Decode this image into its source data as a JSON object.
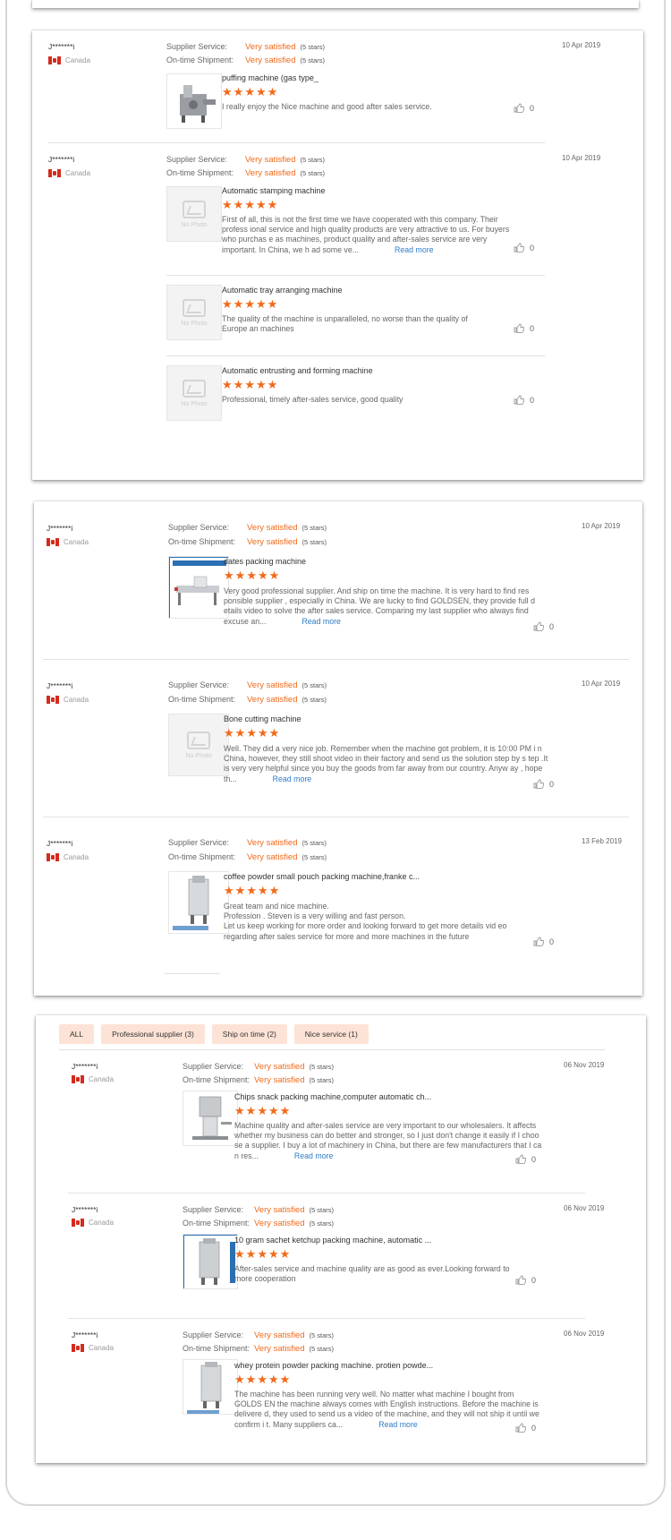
{
  "labels": {
    "supplier_service": "Supplier Service:",
    "ontime_shipment": "On-time Shipment:",
    "very_satisfied": "Very satisfied",
    "five_stars": "(5 stars)",
    "read_more": "Read more",
    "no_photo": "No Photo"
  },
  "filters": [
    "ALL",
    "Professional supplier (3)",
    "Ship on time (2)",
    "Nice service (1)"
  ],
  "card1": {
    "reviews": [
      {
        "user": "J*******i",
        "country": "Canada",
        "date": "10 Apr 2019",
        "products": [
          {
            "title": "puffing machine (gas type_",
            "text": "I really enjoy the Nice machine and good after sales service.",
            "likes": "0",
            "has_photo": true
          }
        ]
      },
      {
        "user": "J*******i",
        "country": "Canada",
        "date": "10 Apr 2019",
        "products": [
          {
            "title": "Automatic stamping machine",
            "text": "First of all, this is not the first time we have cooperated with this company. Their profess ional service and high quality products are very attractive to us. For buyers who purchas e as machines, product quality and after-sales service are very important. In China, we h ad some ve...",
            "likes": "0",
            "has_photo": false,
            "read_more": true
          },
          {
            "title": "Automatic tray arranging machine",
            "text": "The quality of the machine is unparalleled, no worse than the quality of Europe an machines",
            "likes": "0",
            "has_photo": false
          },
          {
            "title": "Automatic entrusting and forming machine",
            "text": "Professional, timely after-sales service, good quality",
            "likes": "0",
            "has_photo": false
          }
        ]
      }
    ]
  },
  "card2": {
    "reviews": [
      {
        "user": "J*******i",
        "country": "Canada",
        "date": "10 Apr 2019",
        "title": "dates packing machine",
        "text": "Very good professional supplier. And ship on time the machine. It is very hard to find res ponsible supplier , especially in China.  We are lucky to find GOLDSEN, they provide full d etails video to solve the after sales service. Comparing my last supplier who always find excuse an...",
        "likes": "0",
        "has_photo": true,
        "read_more": true
      },
      {
        "user": "J*******i",
        "country": "Canada",
        "date": "10 Apr 2019",
        "title": "Bone cutting machine",
        "text": "Well. They did a very nice job. Remember when the machine got problem, it is 10:00 PM i n China, however, they still shoot video in their factory and send us the solution step by s tep .It is very very helpful since you buy the goods from far away from our country. Anyw ay , hope th...",
        "likes": "0",
        "has_photo": false,
        "read_more": true
      },
      {
        "user": "J*******i",
        "country": "Canada",
        "date": "13 Feb 2019",
        "title": "coffee powder small pouch packing machine,franke c...",
        "text": "Great team and nice machine.\nProfession . Steven is a very willing and fast person.\nLet us keep working for more order and looking forward to get more details vid eo regarding after sales service for more and more  machines  in the future",
        "likes": "0",
        "has_photo": true
      }
    ]
  },
  "card3": {
    "reviews": [
      {
        "user": "J*******i",
        "country": "Canada",
        "date": "06 Nov 2019",
        "title": "Chips snack packing machine,computer automatic ch...",
        "text": "Machine quality and after-sales service are very important to our wholesalers. It affects whether my business can do better and stronger, so I just don't change it easily if I choo se a supplier. I buy a lot of machinery in China, but there are few manufacturers that I ca n res...",
        "likes": "0",
        "has_photo": true,
        "read_more": true
      },
      {
        "user": "J*******i",
        "country": "Canada",
        "date": "06 Nov 2019",
        "title": "10 gram sachet ketchup packing machine, automatic ...",
        "text": "After-sales service and machine quality are as good as ever.Looking forward to more cooperation",
        "likes": "0",
        "has_photo": true
      },
      {
        "user": "J*******i",
        "country": "Canada",
        "date": "06 Nov 2019",
        "title": "whey protein powder packing machine. protien powde...",
        "text": "The machine has been running very well. No matter what machine I bought from GOLDS EN the machine always comes with  English instructions. Before the machine is delivere d, they used to send us a video of the machine, and they will not ship it until we confirm i t. Many suppliers ca...",
        "likes": "0",
        "has_photo": true,
        "read_more": true
      }
    ]
  }
}
